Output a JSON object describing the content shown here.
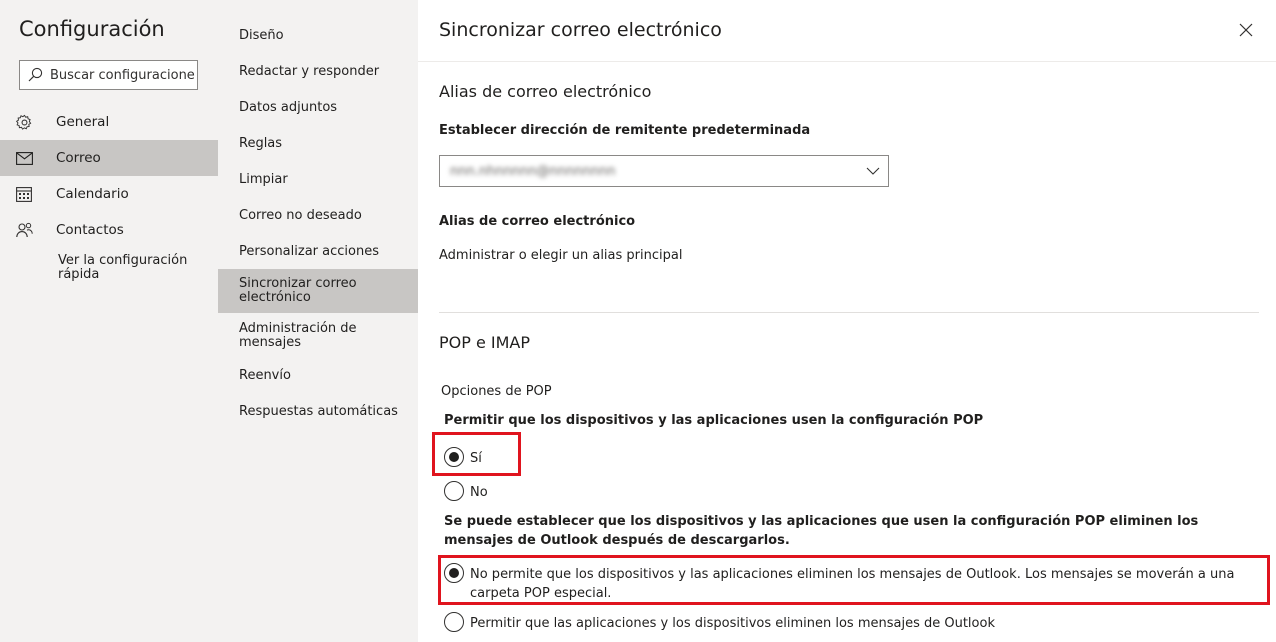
{
  "settings": {
    "title": "Configuración",
    "search_placeholder": "Buscar configuraciones",
    "nav": [
      {
        "label": "General",
        "icon": "gear-icon"
      },
      {
        "label": "Correo",
        "icon": "mail-icon",
        "active": true
      },
      {
        "label": "Calendario",
        "icon": "calendar-icon"
      },
      {
        "label": "Contactos",
        "icon": "contacts-icon"
      }
    ],
    "quick_settings_link": "Ver la configuración rápida"
  },
  "mail_sub": {
    "items": [
      "Diseño",
      "Redactar y responder",
      "Datos adjuntos",
      "Reglas",
      "Limpiar",
      "Correo no deseado",
      "Personalizar acciones",
      "Sincronizar correo electrónico",
      "Administración de mensajes",
      "Reenvío",
      "Respuestas automáticas"
    ],
    "active_index": 7
  },
  "panel": {
    "title": "Sincronizar correo electrónico",
    "alias_section": {
      "heading": "Alias de correo electrónico",
      "default_from_label": "Establecer dirección de remitente predeterminada",
      "default_from_value": "nnn.nhnnnnn@nnnnnnnn",
      "alias_label": "Alias de correo electrónico",
      "manage_link": "Administrar o elegir un alias principal"
    },
    "pop_section": {
      "heading": "POP e IMAP",
      "pop_options_label": "Opciones de POP",
      "allow_pop_question": "Permitir que los dispositivos y las aplicaciones usen la configuración POP",
      "allow_yes": "Sí",
      "allow_no": "No",
      "allow_selected": "yes",
      "delete_question": "Se puede establecer que los dispositivos y las aplicaciones que usen la configuración POP eliminen los mensajes de Outlook después de descargarlos.",
      "delete_option_1": "No permite que los dispositivos y las aplicaciones eliminen los mensajes de Outlook. Los mensajes se moverán a una carpeta POP especial.",
      "delete_option_2": "Permitir que las aplicaciones y los dispositivos eliminen los mensajes de Outlook",
      "delete_selected": 1
    }
  },
  "colors": {
    "highlight": "#e0141e",
    "nav_bg": "#f3f2f1",
    "active_bg": "#c8c6c4"
  }
}
